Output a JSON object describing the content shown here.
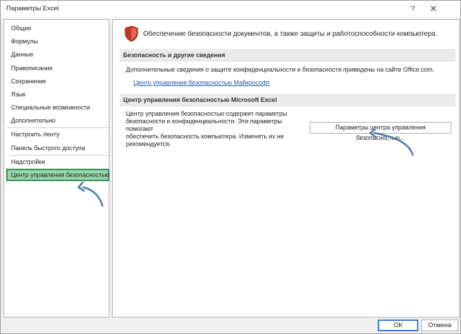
{
  "window": {
    "title": "Параметры Excel",
    "help_glyph": "?",
    "close_glyph": "✕"
  },
  "sidebar": {
    "items": [
      {
        "label": "Общие"
      },
      {
        "label": "Формулы"
      },
      {
        "label": "Данные"
      },
      {
        "label": "Правописание"
      },
      {
        "label": "Сохранение"
      },
      {
        "label": "Язык"
      },
      {
        "label": "Специальные возможности"
      },
      {
        "label": "Дополнительно"
      },
      {
        "label": "Настроить ленту"
      },
      {
        "label": "Панель быстрого доступа"
      },
      {
        "label": "Надстройки"
      },
      {
        "label": "Центр управления безопасностью",
        "selected": true
      }
    ],
    "selected_color": "#96d6a9"
  },
  "main": {
    "header": "Обеспечение безопасности документов, а также защиты и работоспособности компьютера.",
    "section1": {
      "title": "Безопасность и другие сведения",
      "text": "Дополнительные сведения о защите конфиденциальности и безопасности приведены на сайте Office.com.",
      "link": "Центр управления безопасностью Майкрософт"
    },
    "section2": {
      "title": "Центр управления безопасностью Microsoft Excel",
      "text_lines": [
        "Центр управления безопасностью содержит параметры",
        "безопасности и конфиденциальности. Эти параметры помогают",
        "обеспечить безопасность компьютера. Изменять их не",
        "рекомендуется."
      ],
      "button": "Параметры центра управления безопасностью..."
    }
  },
  "footer": {
    "ok": "ОК",
    "cancel": "Отмена"
  },
  "colors": {
    "shield": "#c0392b",
    "link": "#1a5aa6",
    "annotation_arrow": "#4a78a8",
    "accent_border": "#3c7bd4"
  }
}
